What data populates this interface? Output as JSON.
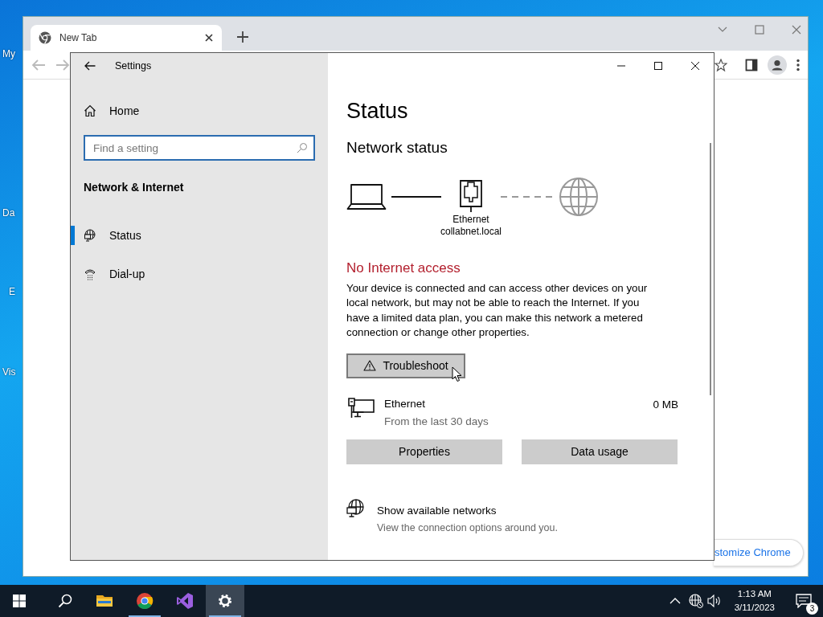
{
  "desktop": {
    "icon_labels": [
      "My",
      "Da",
      "E",
      "Vis"
    ]
  },
  "browser": {
    "tab": {
      "title": "New Tab"
    },
    "customize_button": "stomize Chrome"
  },
  "settings": {
    "window_title": "Settings",
    "home_link": "Home",
    "search": {
      "placeholder": "Find a setting"
    },
    "section_title": "Network & Internet",
    "nav_items": [
      {
        "kind": "globe",
        "label": "Status",
        "selected": true
      },
      {
        "kind": "dialup",
        "label": "Dial-up",
        "selected": false
      }
    ],
    "page_title": "Status",
    "subtitle": "Network status",
    "diagram": {
      "adapter": "Ethernet",
      "network": "collabnet.local",
      "internet": false
    },
    "alert": "No Internet access",
    "description": "Your device is connected and can access other devices on your local network, but may not be able to reach the Internet. If you have a limited data plan, you can make this network a metered connection or change other properties.",
    "troubleshoot_button": "Troubleshoot",
    "usage": {
      "name": "Ethernet",
      "period": "From the last 30 days",
      "amount": "0 MB"
    },
    "buttons": [
      "Properties",
      "Data usage"
    ],
    "link": {
      "title": "Show available networks",
      "description": "View the connection options around you."
    }
  },
  "taskbar": {
    "apps": [
      {
        "kind": "explorer",
        "running": false,
        "active": false
      },
      {
        "kind": "chrome",
        "running": true,
        "active": false
      },
      {
        "kind": "visual-studio",
        "running": false,
        "active": false
      },
      {
        "kind": "settings",
        "running": true,
        "active": true
      }
    ],
    "clock": {
      "time": "1:13 AM",
      "date": "3/11/2023"
    },
    "notification_count": "3"
  }
}
